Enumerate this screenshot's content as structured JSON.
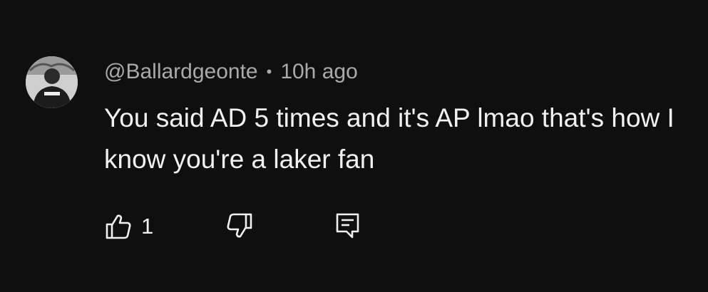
{
  "comment": {
    "author": "@Ballardgeonte",
    "separator": "•",
    "timestamp": "10h ago",
    "text": "You said AD 5 times and it's AP lmao that's how I know you're a laker fan",
    "like_count": "1"
  },
  "icons": {
    "like": "thumbs-up-icon",
    "dislike": "thumbs-down-icon",
    "reply": "reply-icon"
  },
  "colors": {
    "background": "#0f0f0f",
    "primary_text": "#f1f1f1",
    "secondary_text": "#aaaaaa"
  }
}
